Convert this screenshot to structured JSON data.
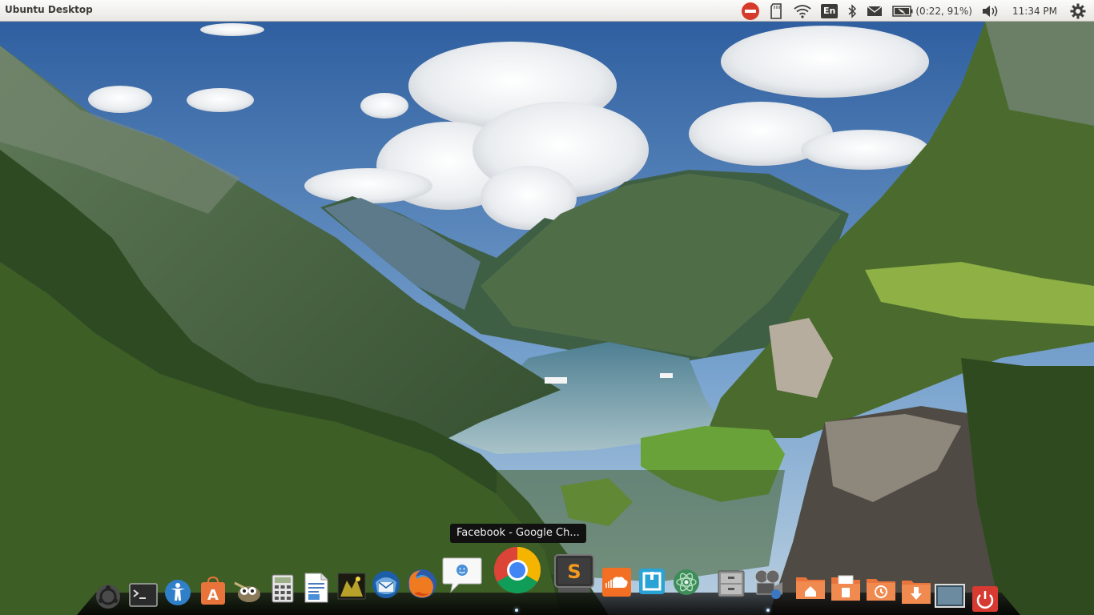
{
  "panel": {
    "app_title": "Ubuntu Desktop",
    "keyboard_layout": "En",
    "battery": "(0:22, 91%)",
    "clock": "11:34 PM",
    "indicators": [
      "do-not-disturb-icon",
      "sd-card-icon",
      "wifi-icon",
      "keyboard-layout-icon",
      "bluetooth-icon",
      "mail-icon",
      "battery-icon",
      "volume-icon",
      "session-gear-icon"
    ]
  },
  "tooltip": {
    "text": "Facebook - Google Ch..."
  },
  "dock": {
    "items": [
      {
        "name": "ubuntu-logo-icon",
        "running": false
      },
      {
        "name": "terminal-icon",
        "running": false
      },
      {
        "name": "accessibility-icon",
        "running": false
      },
      {
        "name": "software-center-icon",
        "running": false
      },
      {
        "name": "gimp-icon",
        "running": false
      },
      {
        "name": "calculator-icon",
        "running": false
      },
      {
        "name": "document-viewer-icon",
        "running": false
      },
      {
        "name": "image-viewer-icon",
        "running": false
      },
      {
        "name": "thunderbird-icon",
        "running": false
      },
      {
        "name": "firefox-icon",
        "running": false
      },
      {
        "name": "empathy-chat-icon",
        "running": false
      },
      {
        "name": "google-chrome-icon",
        "running": true
      },
      {
        "name": "sublime-text-icon",
        "running": false
      },
      {
        "name": "soundcloud-icon",
        "running": false
      },
      {
        "name": "screenshot-tool-icon",
        "running": false
      },
      {
        "name": "atom-editor-icon",
        "running": false
      },
      {
        "name": "files-cabinet-icon",
        "running": false
      },
      {
        "name": "media-player-icon",
        "running": true
      },
      {
        "name": "home-folder-icon",
        "running": false
      },
      {
        "name": "documents-folder-icon",
        "running": false
      },
      {
        "name": "recent-folder-icon",
        "running": false
      },
      {
        "name": "downloads-folder-icon",
        "running": false
      },
      {
        "name": "show-desktop-icon",
        "running": false
      },
      {
        "name": "power-icon",
        "running": false
      }
    ]
  },
  "colors": {
    "panel_bg": "#f2f1ef",
    "panel_text": "#3c3b37",
    "dnd_red": "#d63a2a",
    "chrome_red": "#db4437",
    "chrome_green": "#0f9d58",
    "chrome_yellow": "#f4b400",
    "chrome_blue": "#4285f4",
    "folder_orange": "#e8743b",
    "power_red": "#d73a30"
  }
}
